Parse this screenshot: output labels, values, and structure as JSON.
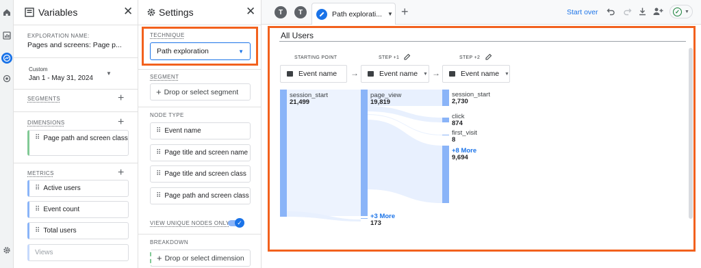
{
  "nav": {
    "icons": [
      "home-icon",
      "reports-icon",
      "explore-icon",
      "advertising-icon",
      "settings-icon"
    ]
  },
  "variables": {
    "title": "Variables",
    "exploration_name_label": "EXPLORATION NAME:",
    "exploration_name": "Pages and screens: Page p...",
    "date_custom": "Custom",
    "date_range": "Jan 1 - May 31, 2024",
    "segments_label": "SEGMENTS",
    "dimensions_label": "DIMENSIONS",
    "dimensions": [
      "Page path and screen class"
    ],
    "metrics_label": "METRICS",
    "metrics": [
      "Active users",
      "Event count",
      "Total users",
      "Views"
    ]
  },
  "settings": {
    "title": "Settings",
    "technique_label": "TECHNIQUE",
    "technique_value": "Path exploration",
    "segment_label": "SEGMENT",
    "segment_drop": "Drop or select segment",
    "node_type_label": "NODE TYPE",
    "node_types": [
      "Event name",
      "Page title and screen name",
      "Page title and screen class",
      "Page path and screen class"
    ],
    "view_unique_label": "VIEW UNIQUE NODES ONLY",
    "view_unique_on": true,
    "breakdown_label": "BREAKDOWN",
    "breakdown_drop": "Drop or select dimension"
  },
  "tabs": {
    "avatars": [
      "T",
      "T"
    ],
    "active_tab": "Path explorati...",
    "start_over": "Start over"
  },
  "canvas": {
    "segment_title": "All Users",
    "steps": [
      {
        "label": "STARTING POINT",
        "select": "Event name"
      },
      {
        "label": "STEP +1",
        "select": "Event name"
      },
      {
        "label": "STEP +2",
        "select": "Event name"
      }
    ],
    "step0_nodes": [
      {
        "name": "session_start",
        "value": "21,499"
      }
    ],
    "step1_nodes": [
      {
        "name": "page_view",
        "value": "19,819"
      }
    ],
    "step1_more": {
      "label": "+3 More",
      "value": "173"
    },
    "step2_nodes": [
      {
        "name": "session_start",
        "value": "2,730"
      },
      {
        "name": "click",
        "value": "874"
      },
      {
        "name": "first_visit",
        "value": "8"
      }
    ],
    "step2_more": {
      "label": "+8 More",
      "value": "9,694"
    }
  },
  "colors": {
    "accent": "#1a73e8",
    "node": "#8ab4f8",
    "highlight": "#f2611d",
    "dimension": "#81c995"
  }
}
